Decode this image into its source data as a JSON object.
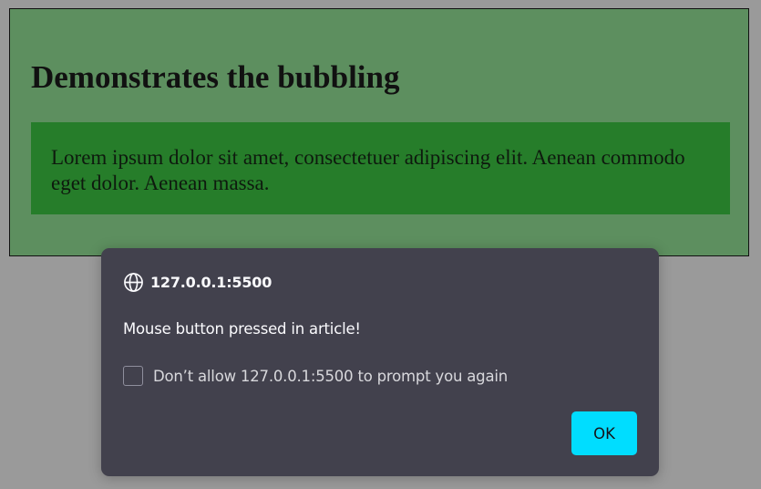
{
  "article": {
    "heading": "Demonstrates the bubbling",
    "paragraph": "Lorem ipsum dolor sit amet, consectetuer adipiscing elit. Aenean commodo eget dolor. Aenean massa."
  },
  "dialog": {
    "origin": "127.0.0.1:5500",
    "message": "Mouse button pressed in article!",
    "checkbox_label": "Don’t allow 127.0.0.1:5500 to prompt you again",
    "checkbox_checked": false,
    "ok_label": "OK",
    "icon": "globe-icon"
  },
  "colors": {
    "backdrop": "#9a9a9a",
    "article_bg": "#5d8f5f",
    "inner_bg": "#267d2a",
    "dialog_bg": "#42414d",
    "ok_button": "#00ddff"
  }
}
